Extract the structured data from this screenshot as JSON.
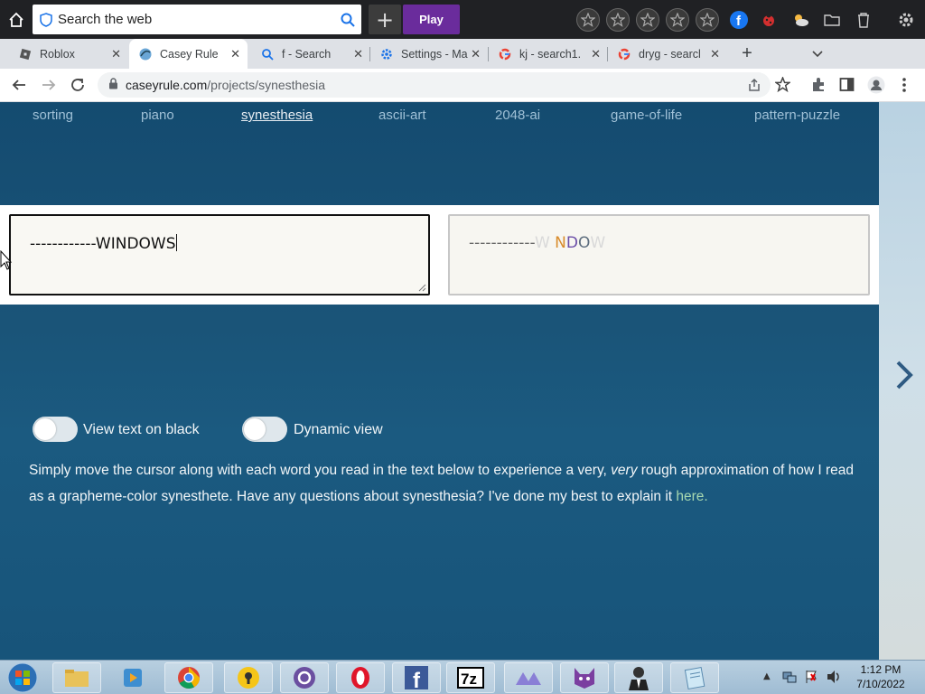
{
  "toolbar": {
    "search_placeholder": "Search the web",
    "play_label": "Play",
    "add_label": "+"
  },
  "tabs": [
    {
      "label": "Roblox",
      "icon": "roblox-icon"
    },
    {
      "label": "Casey Rule",
      "icon": "casey-rule-icon",
      "active": true
    },
    {
      "label": "f - Search",
      "icon": "search-icon"
    },
    {
      "label": "Settings - Ma",
      "icon": "gear-icon"
    },
    {
      "label": "kj - search1.",
      "icon": "google-icon"
    },
    {
      "label": "dryg - searcl",
      "icon": "google-icon"
    }
  ],
  "address": {
    "domain": "caseyrule.com",
    "path": "/projects/synesthesia"
  },
  "nav": {
    "items": [
      "sorting",
      "piano",
      "synesthesia",
      "ascii-art",
      "2048-ai",
      "game-of-life",
      "pattern-puzzle"
    ],
    "current": "synesthesia"
  },
  "editor": {
    "input_text": "------------WINDOWS",
    "output_dashes": "------------",
    "output_letters": [
      {
        "ch": "W",
        "color": "#d9d9d9"
      },
      {
        "ch": " ",
        "color": "#d9d9d9"
      },
      {
        "ch": "N",
        "color": "#d88b2b"
      },
      {
        "ch": "D",
        "color": "#6b4ea8"
      },
      {
        "ch": "O",
        "color": "#5d6d7e"
      },
      {
        "ch": "W",
        "color": "#d9d9d9"
      }
    ]
  },
  "toggles": {
    "view_black_label": "View text on black",
    "dynamic_label": "Dynamic view"
  },
  "description": {
    "part1": "Simply move the cursor along with each word you read in the text below to experience a very, ",
    "emphasis": "very",
    "part2": " rough approximation of how I read as a grapheme-color synesthete. Have any questions about synesthesia? I've done my best to explain it ",
    "link": "here."
  },
  "taskbar": {
    "time": "1:12 PM",
    "date": "7/10/2022"
  },
  "colors": {
    "page_bg": "#144b70",
    "play_button": "#6a2c9c",
    "link": "#a7d8b0"
  }
}
